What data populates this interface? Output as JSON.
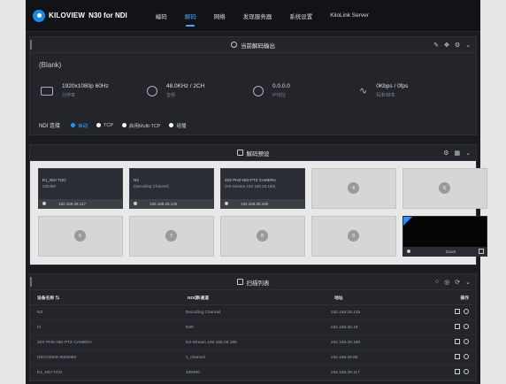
{
  "header": {
    "brand": "KILOVIEW",
    "product": "N30 for NDI",
    "nav": [
      {
        "label": "编码",
        "active": false
      },
      {
        "label": "解码",
        "active": true
      },
      {
        "label": "网络",
        "active": false
      },
      {
        "label": "发现服务器",
        "active": false
      },
      {
        "label": "系统设置",
        "active": false
      },
      {
        "label": "KiloLink Server",
        "active": false
      }
    ]
  },
  "output_panel": {
    "title": "当前解码输出",
    "actions": [
      "✎",
      "✥",
      "⚙",
      "⌄"
    ],
    "source": "(Blank)",
    "stats": [
      {
        "icon": "monitor-icon",
        "main": "1920x1080p 60Hz",
        "sub": "分辨率"
      },
      {
        "icon": "headphones-icon",
        "main": "48.0KHz / 2CH",
        "sub": "音频"
      },
      {
        "icon": "ip-icon",
        "main": "0.0.0.0",
        "sub": "IP地址"
      },
      {
        "icon": "pulse-icon",
        "main": "0Kbps / 0fps",
        "sub": "码率/帧率"
      }
    ],
    "mode_label": "NDI 连接",
    "modes": [
      {
        "label": "自动",
        "on": true
      },
      {
        "label": "TCP",
        "on": false
      },
      {
        "label": "启用Multi-TCP",
        "on": false
      },
      {
        "label": "组播",
        "on": false
      }
    ]
  },
  "preset_panel": {
    "title": "解码预设",
    "actions": [
      "⚙",
      "▦",
      "⌄"
    ],
    "cells": [
      {
        "type": "filled",
        "line1": "E1_NDI TOO",
        "line2": "338490",
        "ip": "192.168.28.117"
      },
      {
        "type": "filled",
        "line1": "N3",
        "line2": "(Decoding Channel)",
        "ip": "192.168.28.135"
      },
      {
        "type": "filled",
        "line1": "20X PHD NDI PTZ CAMERA",
        "line2": "(N3-Stream 192.168.28.180)",
        "ip": "192.168.28.180"
      },
      {
        "type": "empty",
        "num": "4"
      },
      {
        "type": "empty",
        "num": "5"
      },
      {
        "type": "empty",
        "num": "6"
      },
      {
        "type": "empty",
        "num": "7"
      },
      {
        "type": "empty",
        "num": "8"
      },
      {
        "type": "empty",
        "num": "9"
      },
      {
        "type": "black",
        "label": "Zoom"
      }
    ]
  },
  "source_panel": {
    "title": "扫描列表",
    "actions": [
      "○",
      "◎",
      "⟳",
      "⌄"
    ],
    "columns": [
      "设备名称 ⇅",
      "NDI源/通道",
      "地址",
      "操作"
    ],
    "rows": [
      {
        "name": "N3",
        "ndi": "Decoding Channel",
        "addr": "192.168.28.135"
      },
      {
        "name": "f4",
        "ndi": "N30",
        "addr": "192.168.28.19"
      },
      {
        "name": "20X PHD NDI PTZ CAMERA",
        "ndi": "N3-Stream 192.168.28.180",
        "addr": "192.168.28.180"
      },
      {
        "name": "DECODER-0000060",
        "ndi": "1_channel",
        "addr": "192.168.28.86"
      },
      {
        "name": "E1_NDI TOO",
        "ndi": "338490",
        "addr": "192.168.28.117"
      }
    ]
  }
}
